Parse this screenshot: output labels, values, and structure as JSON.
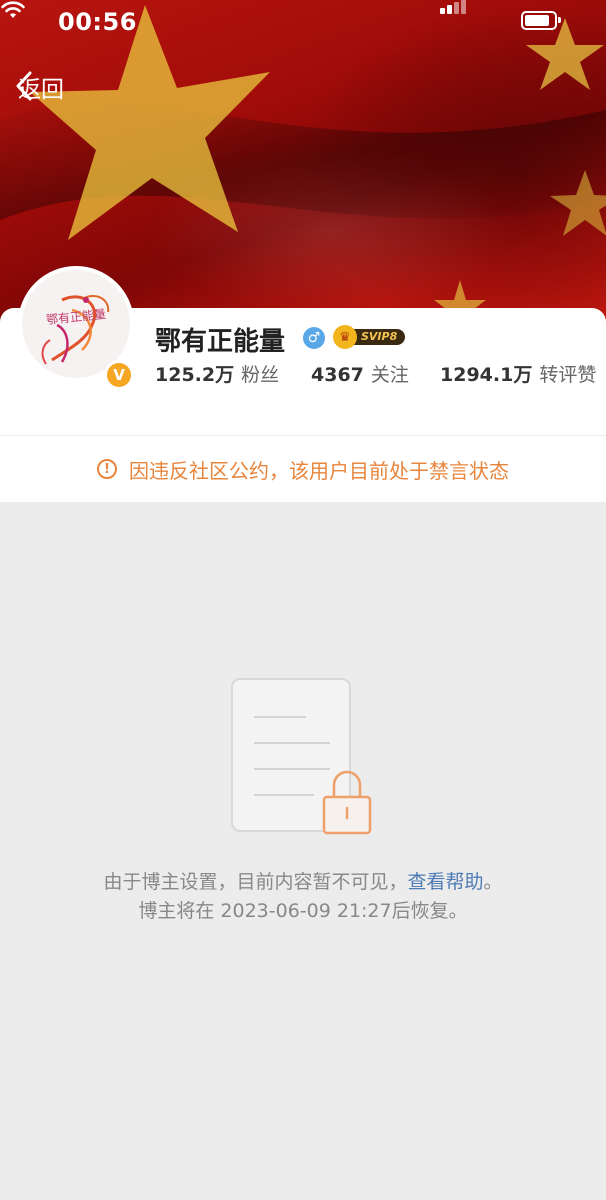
{
  "status_bar": {
    "time": "00:56"
  },
  "nav": {
    "back_label": "返回"
  },
  "profile": {
    "avatar_text": "鄂有正能量",
    "verified_badge": "V",
    "username": "鄂有正能量",
    "gender_symbol": "♂",
    "vip_label": "SVIP8",
    "stats": [
      {
        "value": "125.2万",
        "label": "粉丝"
      },
      {
        "value": "4367",
        "label": "关注"
      },
      {
        "value": "1294.1万",
        "label": "转评赞"
      }
    ]
  },
  "ban_notice": {
    "icon": "!",
    "text": "因违反社区公约，该用户目前处于禁言状态"
  },
  "empty_state": {
    "line1_prefix": "由于博主设置，目前内容暂不可见，",
    "help_link": "查看帮助",
    "line1_suffix": "。",
    "line2": "博主将在 2023-06-09 21:27后恢复。"
  },
  "colors": {
    "accent_orange": "#e8853d",
    "link_blue": "#4d7cb4",
    "banner_red": "#b8150f",
    "page_bg": "#ececec"
  }
}
